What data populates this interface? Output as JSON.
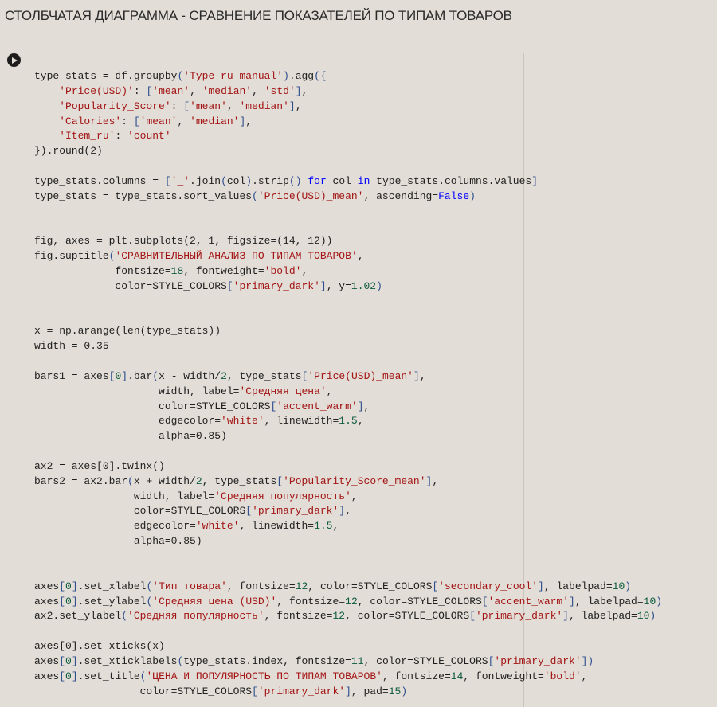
{
  "cell_heading": "СТОЛБЧАТАЯ ДИАГРАММА - СРАВНЕНИЕ ПОКАЗАТЕЛЕЙ ПО ТИПАМ ТОВАРОВ",
  "run_button": {
    "icon": "play-circle-icon"
  },
  "code_lines": [
    "type_stats = df.groupby('Type_ru_manual').agg({",
    "    'Price(USD)': ['mean', 'median', 'std'],",
    "    'Popularity_Score': ['mean', 'median'],",
    "    'Calories': ['mean', 'median'],",
    "    'Item_ru': 'count'",
    "}).round(2)",
    "",
    "type_stats.columns = ['_'.join(col).strip() for col in type_stats.columns.values]",
    "type_stats = type_stats.sort_values('Price(USD)_mean', ascending=False)",
    "",
    "",
    "fig, axes = plt.subplots(2, 1, figsize=(14, 12))",
    "fig.suptitle('СРАВНИТЕЛЬНЫЙ АНАЛИЗ ПО ТИПАМ ТОВАРОВ',",
    "             fontsize=18, fontweight='bold',",
    "             color=STYLE_COLORS['primary_dark'], y=1.02)",
    "",
    "",
    "x = np.arange(len(type_stats))",
    "width = 0.35",
    "",
    "bars1 = axes[0].bar(x - width/2, type_stats['Price(USD)_mean'],",
    "                    width, label='Средняя цена',",
    "                    color=STYLE_COLORS['accent_warm'],",
    "                    edgecolor='white', linewidth=1.5,",
    "                    alpha=0.85)",
    "",
    "ax2 = axes[0].twinx()",
    "bars2 = ax2.bar(x + width/2, type_stats['Popularity_Score_mean'],",
    "                width, label='Средняя популярность',",
    "                color=STYLE_COLORS['primary_dark'],",
    "                edgecolor='white', linewidth=1.5,",
    "                alpha=0.85)",
    "",
    "",
    "axes[0].set_xlabel('Тип товара', fontsize=12, color=STYLE_COLORS['secondary_cool'], labelpad=10)",
    "axes[0].set_ylabel('Средняя цена (USD)', fontsize=12, color=STYLE_COLORS['accent_warm'], labelpad=10)",
    "ax2.set_ylabel('Средняя популярность', fontsize=12, color=STYLE_COLORS['primary_dark'], labelpad=10)",
    "",
    "axes[0].set_xticks(x)",
    "axes[0].set_xticklabels(type_stats.index, fontsize=11, color=STYLE_COLORS['primary_dark'])",
    "axes[0].set_title('ЦЕНА И ПОПУЛЯРНОСТЬ ПО ТИПАМ ТОВАРОВ', fontsize=14, fontweight='bold',",
    "                 color=STYLE_COLORS['primary_dark'], pad=15)"
  ]
}
